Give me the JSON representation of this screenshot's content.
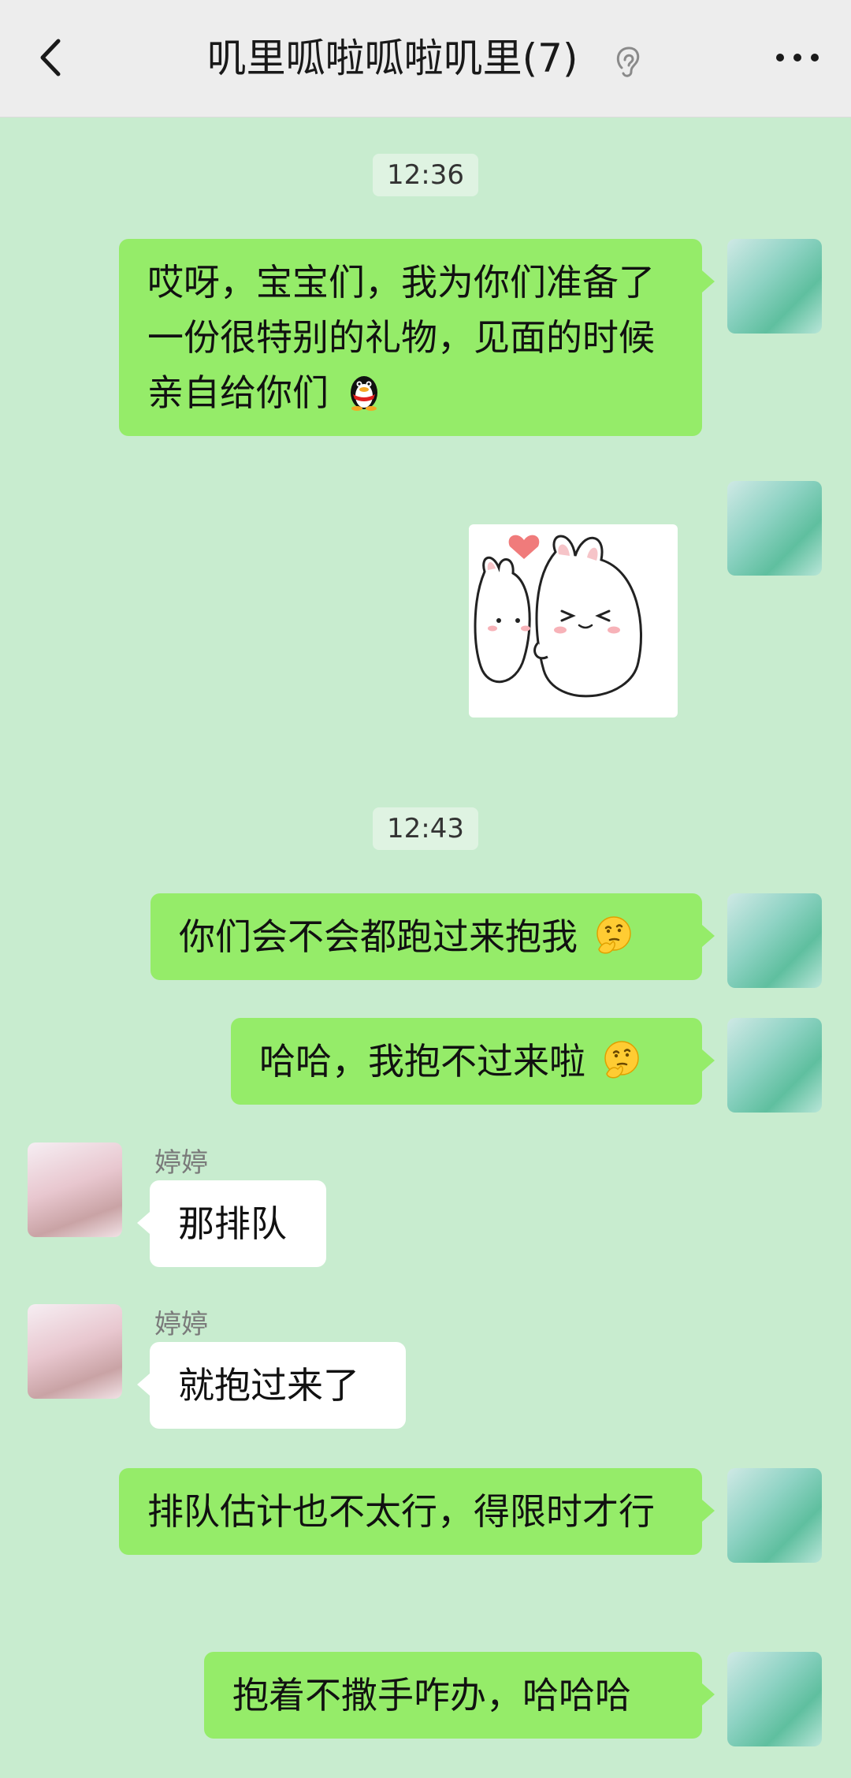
{
  "header": {
    "title": "叽里呱啦呱啦叽里(7)",
    "back_icon": "chevron-left-icon",
    "mute_icon": "ear-icon",
    "more_icon": "more-dots-icon"
  },
  "timestamps": [
    "12:36",
    "12:43"
  ],
  "messages": [
    {
      "from": "me",
      "text": "哎呀，宝宝们，我为你们准备了一份很特别的礼物，见面的时候亲自给你们",
      "emoji": "qq-penguin-emoji"
    },
    {
      "from": "me",
      "type": "sticker",
      "sticker": "two-hugging-bunnies-sticker"
    },
    {
      "from": "me",
      "text": "你们会不会都跑过来抱我",
      "emoji": "thinking-face-emoji"
    },
    {
      "from": "me",
      "text": "哈哈，我抱不过来啦",
      "emoji": "thinking-face-emoji"
    },
    {
      "from": "her",
      "sender": "婷婷",
      "text": "那排队"
    },
    {
      "from": "her",
      "sender": "婷婷",
      "text": "就抱过来了"
    },
    {
      "from": "me",
      "text": "排队估计也不太行，得限时才行"
    },
    {
      "from": "me",
      "text": "抱着不撒手咋办，哈哈哈"
    }
  ],
  "colors": {
    "background": "#c8eccf",
    "my_bubble": "#95ec69",
    "their_bubble": "#ffffff"
  }
}
